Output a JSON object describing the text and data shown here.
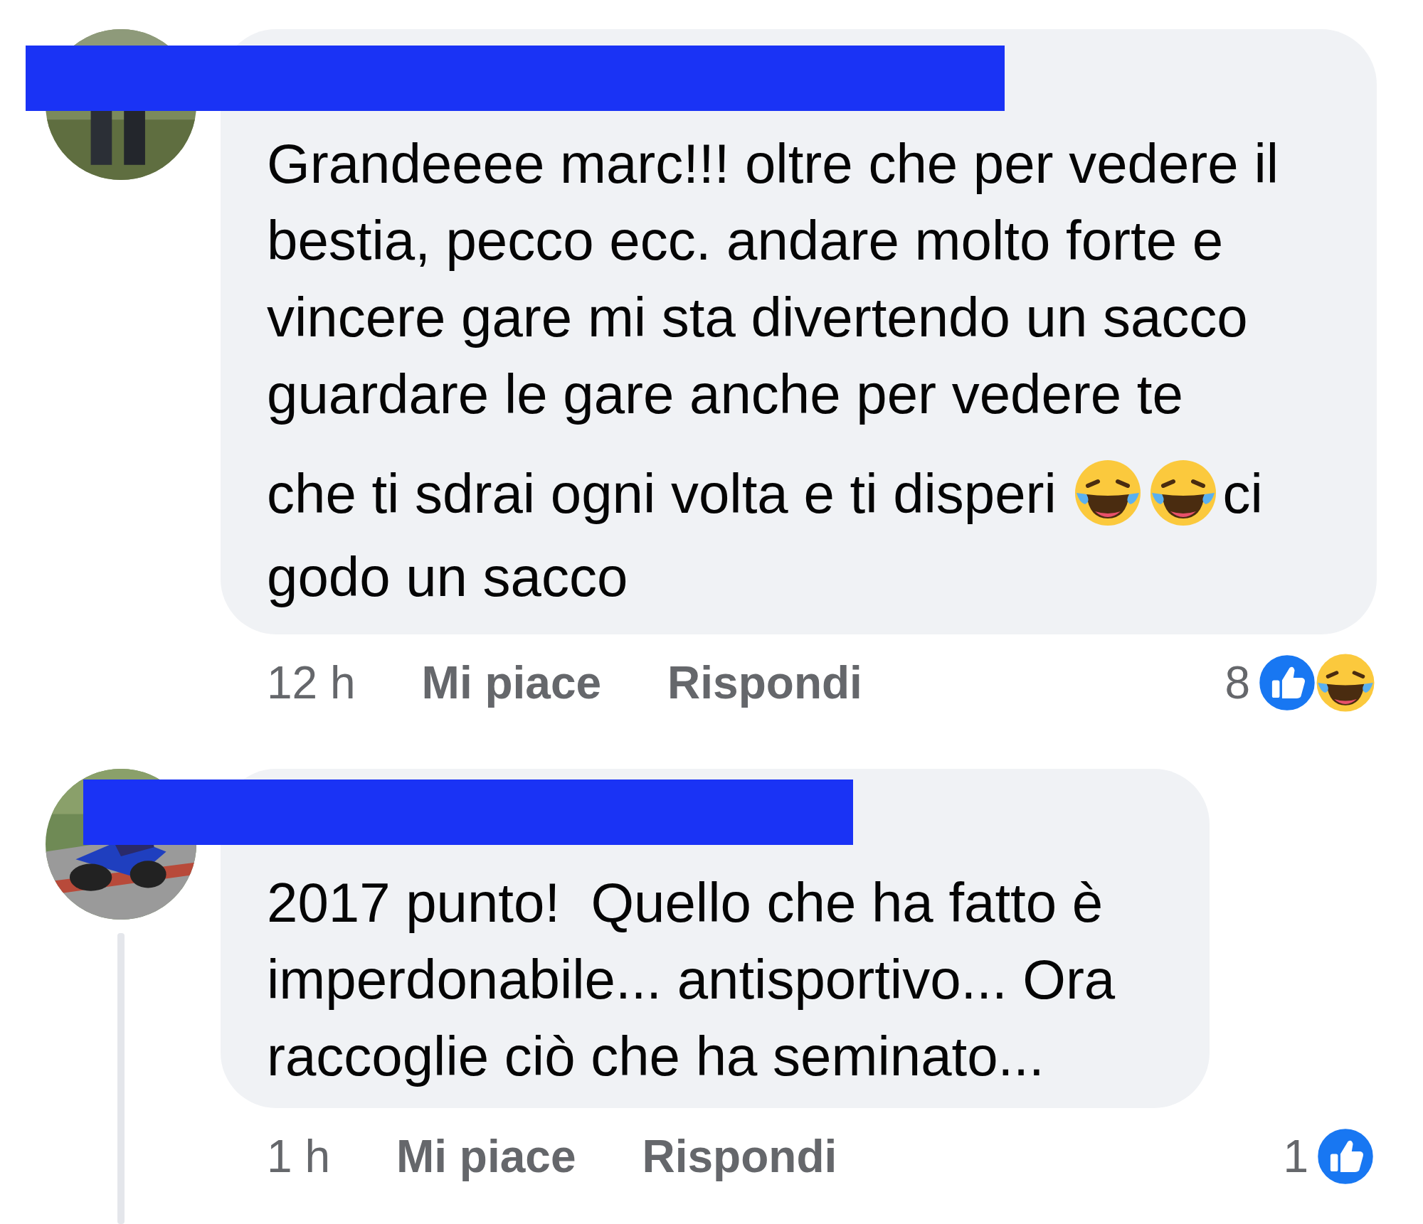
{
  "comments": [
    {
      "avatar": {
        "kind": "picture"
      },
      "body": [
        {
          "kind": "paragraph",
          "segments": [
            {
              "kind": "text",
              "text": "Grandeeee marc!!! oltre che per vedere il bestia, pecco ecc. andare molto forte e vincere gare mi sta divertendo un sacco guardare le gare anche per vedere te"
            }
          ]
        },
        {
          "kind": "paragraph",
          "segments": [
            {
              "kind": "text",
              "text": "che ti sdrai ogni volta e ti disperi"
            },
            {
              "kind": "emoji"
            },
            {
              "kind": "emoji"
            },
            {
              "kind": "text",
              "text": "ci"
            },
            {
              "kind": "text",
              "text": "godo un sacco"
            }
          ]
        }
      ],
      "time": "12 h",
      "like_label": "Mi piace",
      "reply_label": "Rispondi",
      "reaction_count": "8",
      "reactions": [
        {
          "kind": "like"
        },
        {
          "kind": "haha"
        }
      ],
      "thread_line": false
    },
    {
      "avatar": {
        "kind": "picture"
      },
      "body": [
        {
          "kind": "paragraph",
          "segments": [
            {
              "kind": "text",
              "text": "2017 punto!  Quello che ha fatto è imperdonabile... antisportivo... Ora raccoglie ciò che ha seminato..."
            }
          ]
        }
      ],
      "time": "1 h",
      "like_label": "Mi piace",
      "reply_label": "Rispondi",
      "reaction_count": "1",
      "reactions": [
        {
          "kind": "like"
        }
      ],
      "thread_line": true
    }
  ]
}
